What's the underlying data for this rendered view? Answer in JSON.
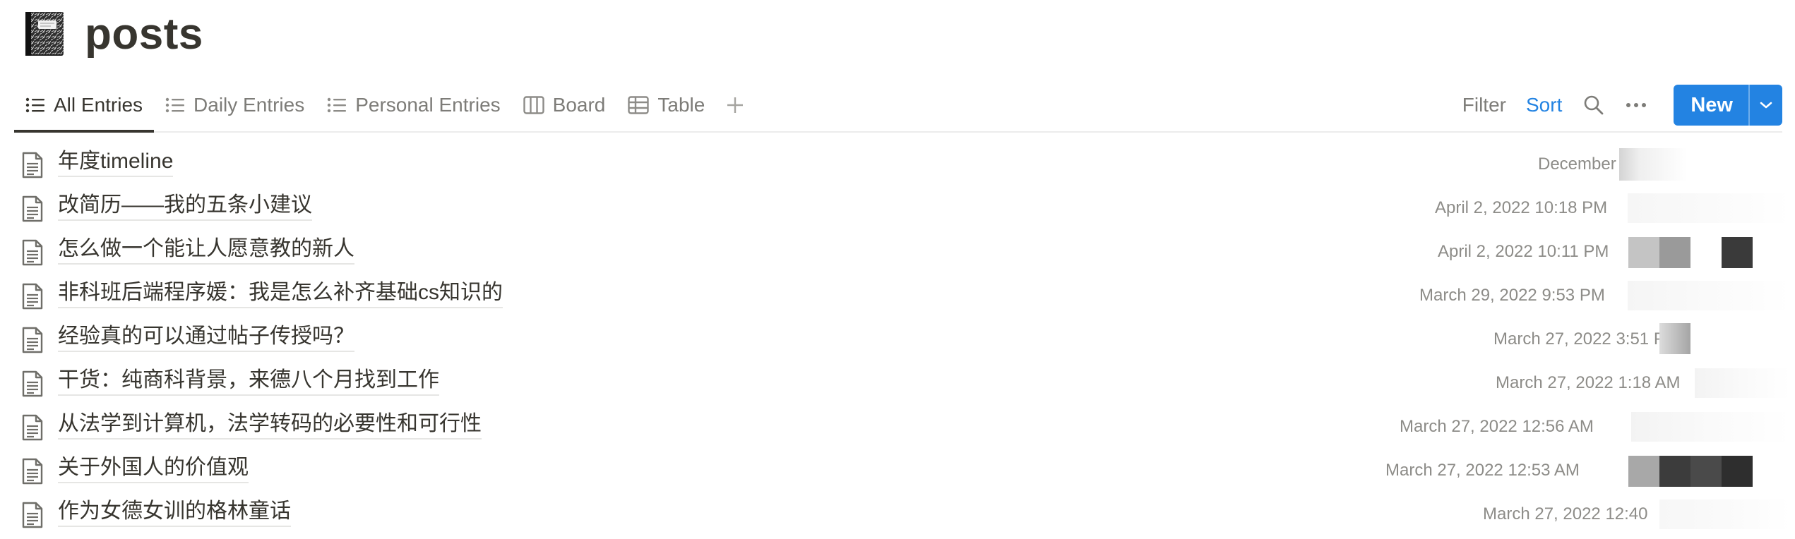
{
  "page": {
    "title": "posts",
    "icon": "notebook-icon"
  },
  "views": [
    {
      "label": "All Entries",
      "icon": "list-icon",
      "active": true
    },
    {
      "label": "Daily Entries",
      "icon": "list-icon",
      "active": false
    },
    {
      "label": "Personal Entries",
      "icon": "list-icon",
      "active": false
    },
    {
      "label": "Board",
      "icon": "board-icon",
      "active": false
    },
    {
      "label": "Table",
      "icon": "table-icon",
      "active": false
    }
  ],
  "toolbar": {
    "filter": "Filter",
    "sort": "Sort",
    "new": "New"
  },
  "colors": {
    "accent": "#2383e2",
    "text": "#37352f",
    "muted": "#7d7c78"
  },
  "entries": [
    {
      "title": "年度timeline",
      "date": "December 1"
    },
    {
      "title": "改简历——我的五条小建议",
      "date": "April 2, 2022 10:18 PM"
    },
    {
      "title": "怎么做一个能让人愿意教的新人",
      "date": "April 2, 2022 10:11 PM"
    },
    {
      "title": "非科班后端程序媛：我是怎么补齐基础cs知识的",
      "date": "March 29, 2022 9:53 PM"
    },
    {
      "title": "经验真的可以通过帖子传授吗？",
      "date": "March 27, 2022 3:51 PM"
    },
    {
      "title": "干货：纯商科背景，来德八个月找到工作",
      "date": "March 27, 2022 1:18 AM"
    },
    {
      "title": "从法学到计算机，法学转码的必要性和可行性",
      "date": "March 27, 2022 12:56 AM"
    },
    {
      "title": "关于外国人的价值观",
      "date": "March 27, 2022 12:53 AM"
    },
    {
      "title": "作为女德女训的格林童话",
      "date": "March 27, 2022 12:40"
    }
  ]
}
